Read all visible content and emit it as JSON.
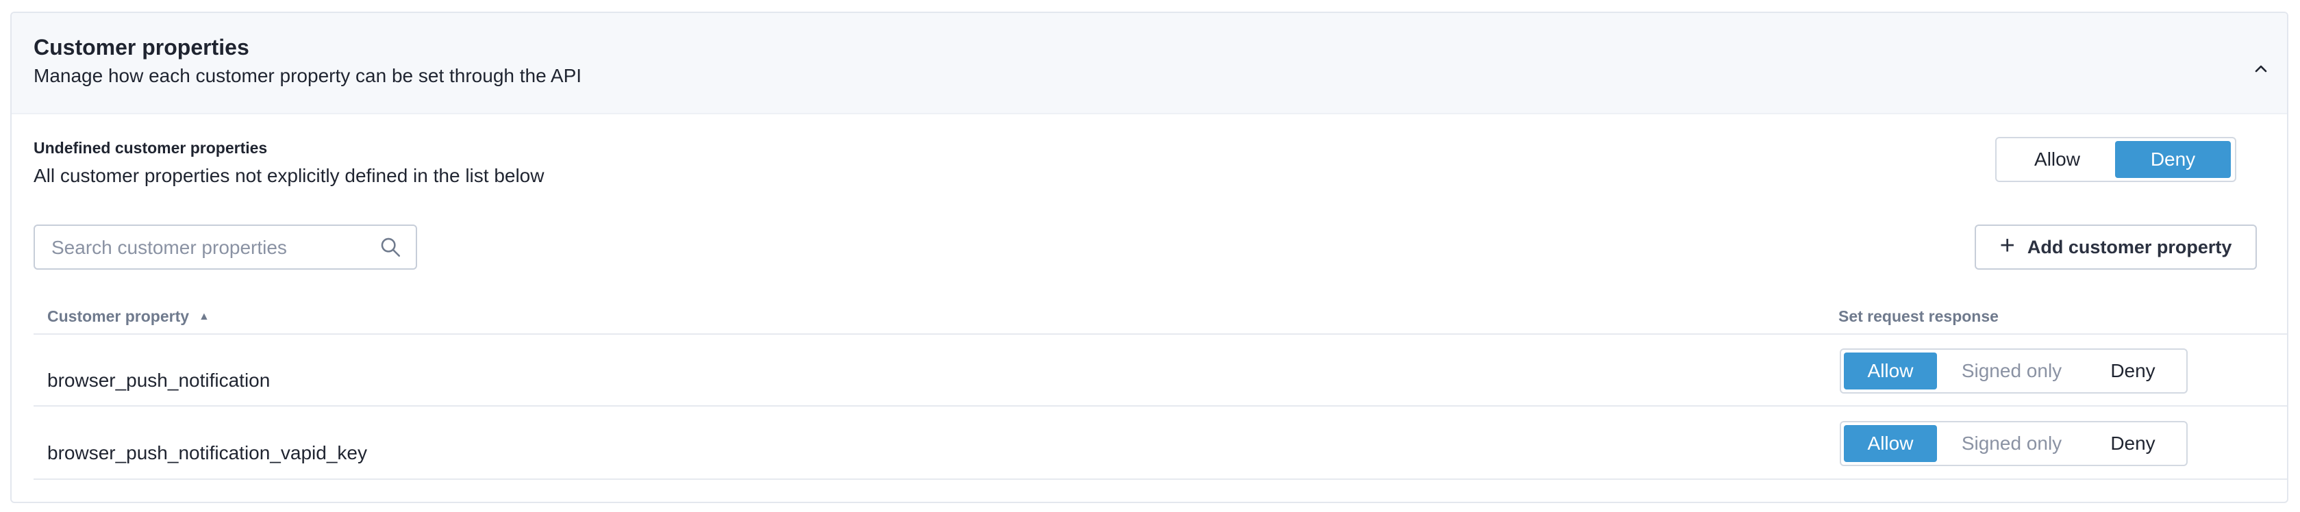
{
  "section": {
    "title": "Customer properties",
    "subtitle": "Manage how each customer property can be set through the API"
  },
  "undefined_properties": {
    "title": "Undefined customer properties",
    "description": "All customer properties not explicitly defined in the list below",
    "options": [
      "Allow",
      "Deny"
    ],
    "selected": "Deny"
  },
  "search": {
    "placeholder": "Search customer properties",
    "value": ""
  },
  "add_button": {
    "label": "Add customer property"
  },
  "table": {
    "columns": [
      "Customer property",
      "Set request response"
    ],
    "sort": "ascending",
    "rows": [
      {
        "property": "browser_push_notification",
        "options": [
          "Allow",
          "Signed only",
          "Deny"
        ],
        "selected": "Allow"
      },
      {
        "property": "browser_push_notification_vapid_key",
        "options": [
          "Allow",
          "Signed only",
          "Deny"
        ],
        "selected": "Allow"
      }
    ]
  },
  "colors": {
    "accent": "#3b97d3",
    "header_bg": "#f6f8fb",
    "border": "#e3e7ee",
    "muted_text": "#8a92a3"
  },
  "icons": [
    "chevron-up-icon",
    "search-icon",
    "plus-icon",
    "sort-ascending-icon"
  ]
}
